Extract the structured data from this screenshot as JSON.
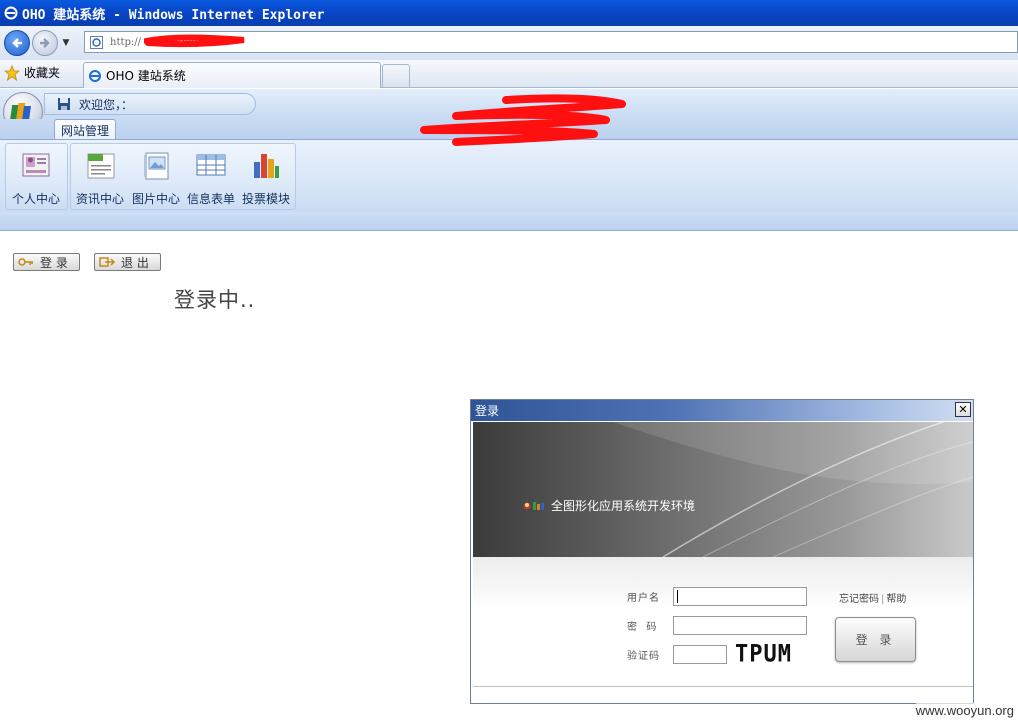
{
  "window": {
    "title": "OHO 建站系统 - Windows Internet Explorer"
  },
  "browser": {
    "url": "http://                    anager.php",
    "favorites_label": "收藏夹",
    "tab_title": "OHO 建站系统"
  },
  "app": {
    "welcome": "欢迎您，：",
    "ribbon_tab": "网站管理",
    "buttons": [
      {
        "label": "个人中心",
        "icon": "user-card-icon"
      },
      {
        "label": "资讯中心",
        "icon": "news-icon"
      },
      {
        "label": "图片中心",
        "icon": "picture-icon"
      },
      {
        "label": "信息表单",
        "icon": "table-form-icon"
      },
      {
        "label": "投票模块",
        "icon": "bar-chart-icon"
      }
    ]
  },
  "page": {
    "login_button": "登 录",
    "logout_button": "退 出",
    "loading_text": "登录中.."
  },
  "dialog": {
    "title": "登录",
    "close_glyph": "✕",
    "tagline": "全图形化应用系统开发环境",
    "username_label": "用户名",
    "password_label": "密  码",
    "captcha_label": "验证码",
    "captcha_text": "TPUM",
    "forgot_password": "忘记密码",
    "separator": "|",
    "help": "帮助",
    "submit": "登 录"
  },
  "watermark": "www.wooyun.org",
  "colors": {
    "title_bar": "#0a47c9",
    "ribbon_blue": "#c7daf3",
    "redaction": "#ff0000"
  }
}
